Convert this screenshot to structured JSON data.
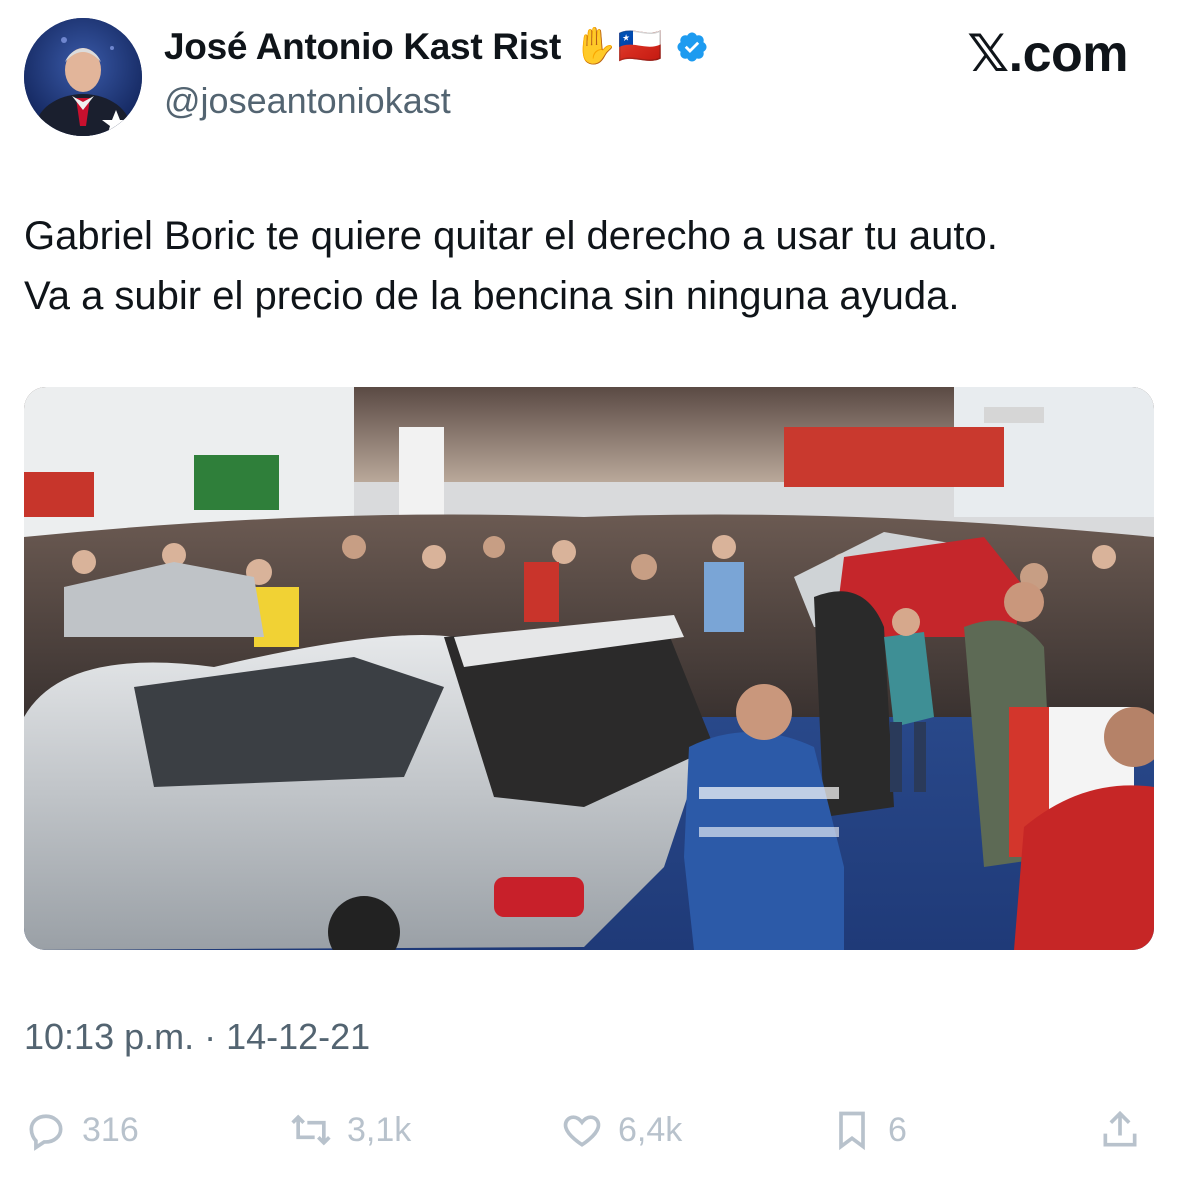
{
  "author": {
    "name": "José Antonio Kast Rist",
    "emojis": "✋🇨🇱",
    "handle": "@joseantoniokast",
    "verified_color": "#1d9bf0"
  },
  "brand": {
    "x": "𝕏",
    "domain": ".com"
  },
  "tweet": {
    "lines": [
      "Gabriel Boric te quiere quitar el derecho a usar tu auto.",
      "Va a subir el precio de la bencina sin ninguna ayuda."
    ],
    "timestamp": "10:13 p.m. · 14-12-21"
  },
  "actions": {
    "replies": "316",
    "reposts": "3,1k",
    "likes": "6,4k",
    "bookmarks": "6"
  },
  "icons": [
    "reply-icon",
    "repost-icon",
    "like-icon",
    "bookmark-icon",
    "share-icon",
    "verified-badge-icon"
  ]
}
